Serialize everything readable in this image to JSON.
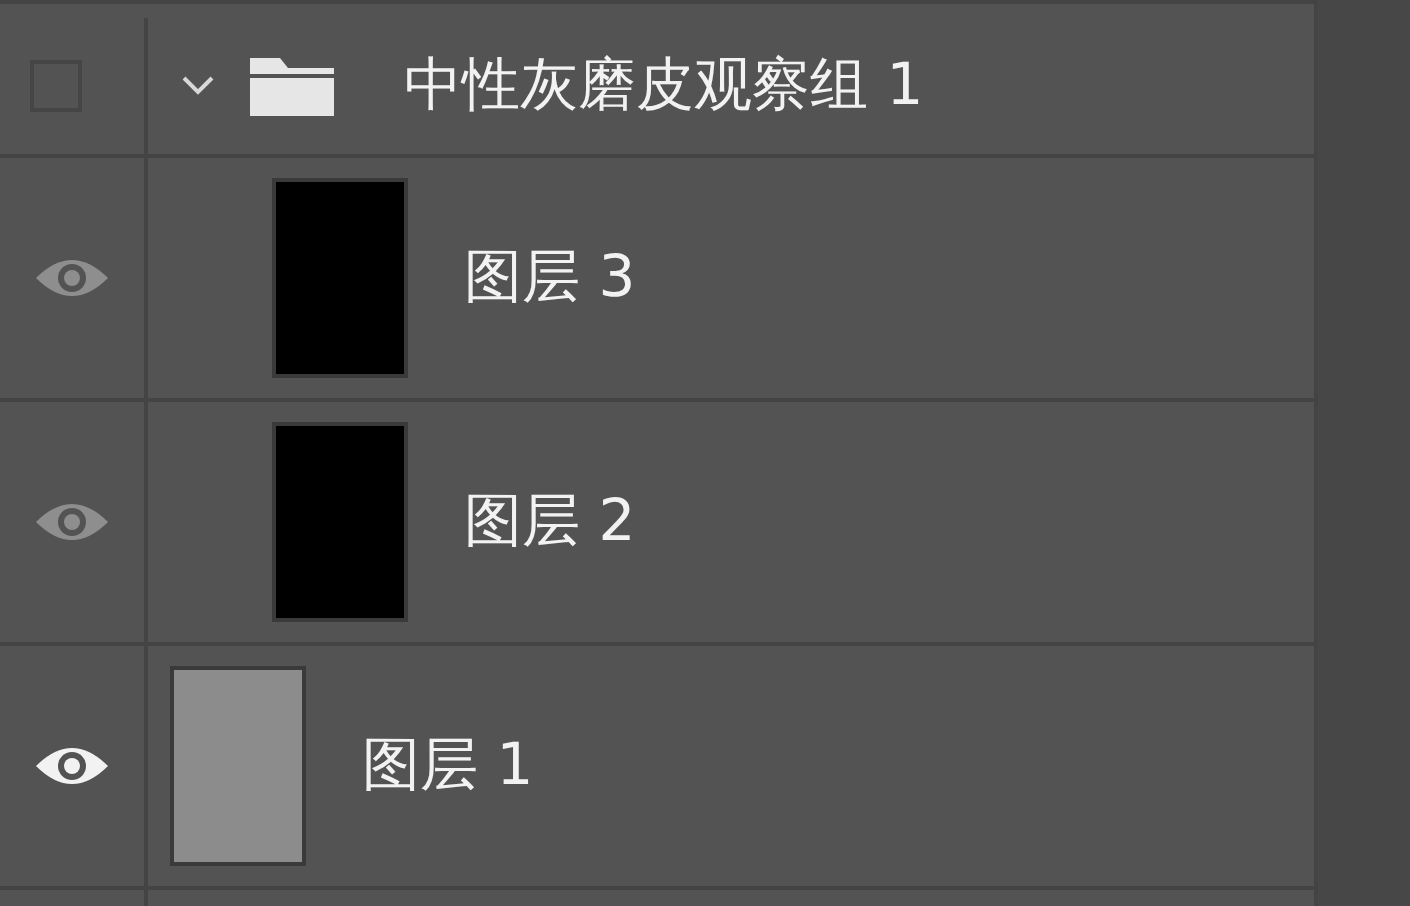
{
  "layers": [
    {
      "name": "中性灰磨皮观察组 1",
      "kind": "group",
      "visible": false,
      "expanded": true,
      "children": [
        {
          "name": "图层 3",
          "kind": "layer",
          "visible": true,
          "color": "#000000"
        },
        {
          "name": "图层 2",
          "kind": "layer",
          "visible": true,
          "color": "#000000"
        }
      ]
    },
    {
      "name": "图层 1",
      "kind": "layer",
      "visible": true,
      "color": "#8c8c8c"
    }
  ]
}
